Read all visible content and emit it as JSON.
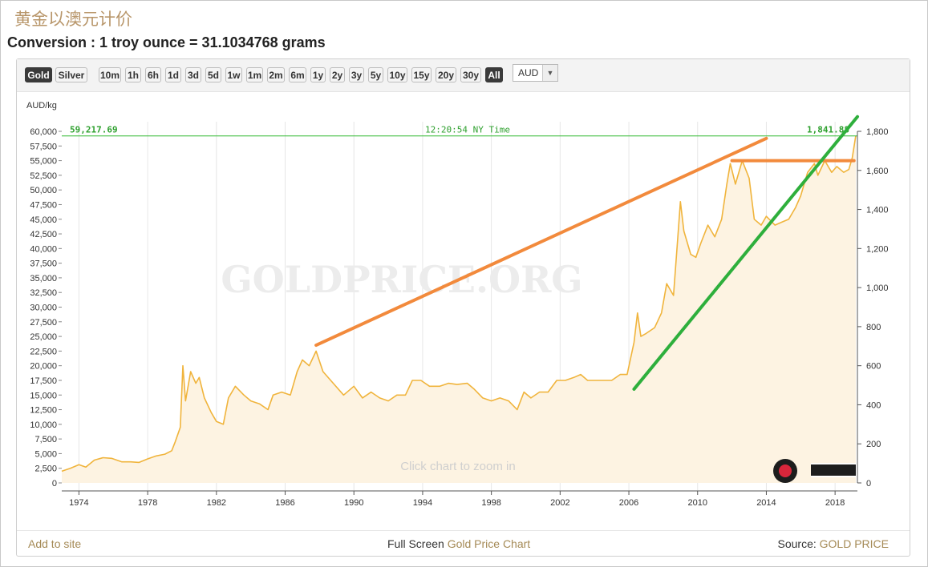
{
  "page": {
    "title_cn": "黄金以澳元计价",
    "conversion": "Conversion : 1 troy ounce = 31.1034768 grams"
  },
  "toolbar": {
    "metal_buttons": [
      {
        "label": "Gold",
        "active": true
      },
      {
        "label": "Silver",
        "active": false
      }
    ],
    "range_buttons": [
      "10m",
      "1h",
      "6h",
      "1d",
      "3d",
      "5d",
      "1w",
      "1m",
      "2m",
      "6m",
      "1y",
      "2y",
      "3y",
      "5y",
      "10y",
      "15y",
      "20y",
      "30y",
      "All"
    ],
    "active_range": "All",
    "currency_value": "AUD",
    "dropdown_icon": "chevron-down-icon"
  },
  "chart_data": {
    "type": "area",
    "y_unit_label": "AUD/kg",
    "left_axis": {
      "min": 0,
      "max": 60000,
      "ticks": [
        "0",
        "2,500",
        "5,000",
        "7,500",
        "10,000",
        "12,500",
        "15,000",
        "17,500",
        "20,000",
        "22,500",
        "25,000",
        "27,500",
        "30,000",
        "32,500",
        "35,000",
        "37,500",
        "40,000",
        "42,500",
        "45,000",
        "47,500",
        "50,000",
        "52,500",
        "55,000",
        "57,500",
        "60,000"
      ]
    },
    "right_axis": {
      "min": 0,
      "max": 1800,
      "ticks": [
        "0",
        "200",
        "400",
        "600",
        "800",
        "1,000",
        "1,200",
        "1,400",
        "1,600",
        "1,800"
      ]
    },
    "x_axis": {
      "min": 1973,
      "max": 2019.3,
      "ticks": [
        "1974",
        "1978",
        "1982",
        "1986",
        "1990",
        "1994",
        "1998",
        "2002",
        "2006",
        "2010",
        "2014",
        "2018"
      ]
    },
    "current_price_left": "59,217.69",
    "current_price_right": "1,841.88",
    "current_time": "12:20:54 NY Time",
    "zoom_hint": "Click chart to zoom in",
    "watermark": "GOLDPRICE.ORG",
    "series": [
      {
        "name": "Gold",
        "unit": "AUD/kg",
        "color": "#f0b43c",
        "fill": "#fdf3e2",
        "points": [
          [
            1973.0,
            2000
          ],
          [
            1973.5,
            2500
          ],
          [
            1974.0,
            3100
          ],
          [
            1974.4,
            2700
          ],
          [
            1974.9,
            3900
          ],
          [
            1975.4,
            4300
          ],
          [
            1975.9,
            4200
          ],
          [
            1976.5,
            3600
          ],
          [
            1977.0,
            3600
          ],
          [
            1977.5,
            3500
          ],
          [
            1978.0,
            4100
          ],
          [
            1978.5,
            4600
          ],
          [
            1979.0,
            4900
          ],
          [
            1979.4,
            5500
          ],
          [
            1979.6,
            7000
          ],
          [
            1979.9,
            9500
          ],
          [
            1980.05,
            20000
          ],
          [
            1980.2,
            14000
          ],
          [
            1980.5,
            19000
          ],
          [
            1980.8,
            17000
          ],
          [
            1981.0,
            18000
          ],
          [
            1981.3,
            14500
          ],
          [
            1981.7,
            12000
          ],
          [
            1982.0,
            10500
          ],
          [
            1982.4,
            10000
          ],
          [
            1982.7,
            14500
          ],
          [
            1983.1,
            16500
          ],
          [
            1983.6,
            15000
          ],
          [
            1984.0,
            14000
          ],
          [
            1984.5,
            13500
          ],
          [
            1985.0,
            12500
          ],
          [
            1985.3,
            15000
          ],
          [
            1985.8,
            15500
          ],
          [
            1986.3,
            15000
          ],
          [
            1986.7,
            19000
          ],
          [
            1987.0,
            21000
          ],
          [
            1987.4,
            20000
          ],
          [
            1987.8,
            22500
          ],
          [
            1988.2,
            19000
          ],
          [
            1988.8,
            17000
          ],
          [
            1989.4,
            15000
          ],
          [
            1990.0,
            16500
          ],
          [
            1990.5,
            14500
          ],
          [
            1991.0,
            15500
          ],
          [
            1991.5,
            14500
          ],
          [
            1992.0,
            14000
          ],
          [
            1992.5,
            15000
          ],
          [
            1993.0,
            15000
          ],
          [
            1993.4,
            17500
          ],
          [
            1993.9,
            17500
          ],
          [
            1994.4,
            16500
          ],
          [
            1995.0,
            16500
          ],
          [
            1995.5,
            17000
          ],
          [
            1996.0,
            16800
          ],
          [
            1996.6,
            17000
          ],
          [
            1997.0,
            16000
          ],
          [
            1997.5,
            14500
          ],
          [
            1998.0,
            14000
          ],
          [
            1998.5,
            14500
          ],
          [
            1999.0,
            14000
          ],
          [
            1999.5,
            12500
          ],
          [
            1999.9,
            15500
          ],
          [
            2000.3,
            14500
          ],
          [
            2000.8,
            15500
          ],
          [
            2001.3,
            15500
          ],
          [
            2001.8,
            17500
          ],
          [
            2002.3,
            17500
          ],
          [
            2002.8,
            18000
          ],
          [
            2003.2,
            18500
          ],
          [
            2003.6,
            17500
          ],
          [
            2004.0,
            17500
          ],
          [
            2004.5,
            17500
          ],
          [
            2005.0,
            17500
          ],
          [
            2005.5,
            18500
          ],
          [
            2005.9,
            18500
          ],
          [
            2006.3,
            24000
          ],
          [
            2006.5,
            29000
          ],
          [
            2006.7,
            25000
          ],
          [
            2007.0,
            25500
          ],
          [
            2007.5,
            26500
          ],
          [
            2007.9,
            29000
          ],
          [
            2008.2,
            34000
          ],
          [
            2008.6,
            32000
          ],
          [
            2008.9,
            44000
          ],
          [
            2009.0,
            48000
          ],
          [
            2009.2,
            43000
          ],
          [
            2009.6,
            39000
          ],
          [
            2009.9,
            38500
          ],
          [
            2010.2,
            41000
          ],
          [
            2010.6,
            44000
          ],
          [
            2011.0,
            42000
          ],
          [
            2011.4,
            45000
          ],
          [
            2011.7,
            51000
          ],
          [
            2011.9,
            54500
          ],
          [
            2012.2,
            51000
          ],
          [
            2012.6,
            55000
          ],
          [
            2013.0,
            52000
          ],
          [
            2013.3,
            45000
          ],
          [
            2013.7,
            44000
          ],
          [
            2014.0,
            45500
          ],
          [
            2014.5,
            44000
          ],
          [
            2014.9,
            44500
          ],
          [
            2015.3,
            45000
          ],
          [
            2015.7,
            47000
          ],
          [
            2016.0,
            49000
          ],
          [
            2016.4,
            53000
          ],
          [
            2016.8,
            54500
          ],
          [
            2017.0,
            52500
          ],
          [
            2017.4,
            55000
          ],
          [
            2017.8,
            53000
          ],
          [
            2018.1,
            54000
          ],
          [
            2018.5,
            53000
          ],
          [
            2018.8,
            53500
          ],
          [
            2019.0,
            55500
          ],
          [
            2019.2,
            59217.69
          ]
        ]
      }
    ],
    "annotations": [
      {
        "type": "trend-line",
        "color": "#f28a3c",
        "from": [
          1987.8,
          23500
        ],
        "to": [
          2014.0,
          58800
        ]
      },
      {
        "type": "horizontal-line",
        "color": "#f28a3c",
        "from": [
          2012.0,
          55000
        ],
        "to": [
          2019.1,
          55000
        ]
      },
      {
        "type": "trend-line",
        "color": "#2eaf3c",
        "from": [
          2006.3,
          16000
        ],
        "to": [
          2019.3,
          62500
        ]
      },
      {
        "type": "current-price-line",
        "color": "#2eb82e",
        "y": 59217.69
      }
    ],
    "grid": "vertical"
  },
  "footer": {
    "add_to_site": "Add to site",
    "full_screen_prefix": "Full Screen",
    "full_screen_link": "Gold Price Chart",
    "source_prefix": "Source:",
    "source_link": "GOLD PRICE"
  }
}
